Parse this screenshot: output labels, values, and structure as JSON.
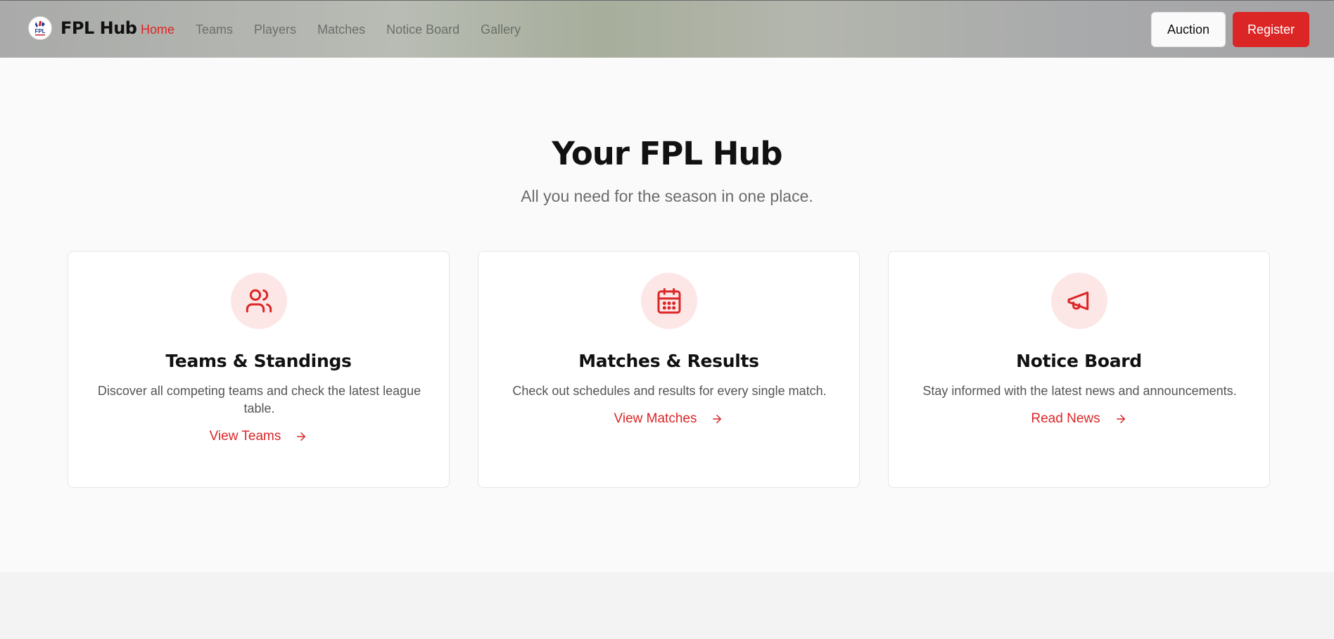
{
  "header": {
    "brand": "FPL Hub",
    "logo_icon": "fpl-logo",
    "nav": [
      {
        "label": "Home",
        "active": true
      },
      {
        "label": "Teams",
        "active": false
      },
      {
        "label": "Players",
        "active": false
      },
      {
        "label": "Matches",
        "active": false
      },
      {
        "label": "Notice Board",
        "active": false
      },
      {
        "label": "Gallery",
        "active": false
      }
    ],
    "auction_label": "Auction",
    "register_label": "Register"
  },
  "hero": {
    "title": "Your FPL Hub",
    "subtitle": "All you need for the season in one place."
  },
  "cards": [
    {
      "icon": "users-icon",
      "title": "Teams & Standings",
      "description": "Discover all competing teams and check the latest league table.",
      "link_label": "View Teams"
    },
    {
      "icon": "calendar-icon",
      "title": "Matches & Results",
      "description": "Check out schedules and results for every single match.",
      "link_label": "View Matches"
    },
    {
      "icon": "megaphone-icon",
      "title": "Notice Board",
      "description": "Stay informed with the latest news and announcements.",
      "link_label": "Read News"
    }
  ],
  "colors": {
    "accent": "#dc2626",
    "icon_bg": "#fde6e6"
  }
}
